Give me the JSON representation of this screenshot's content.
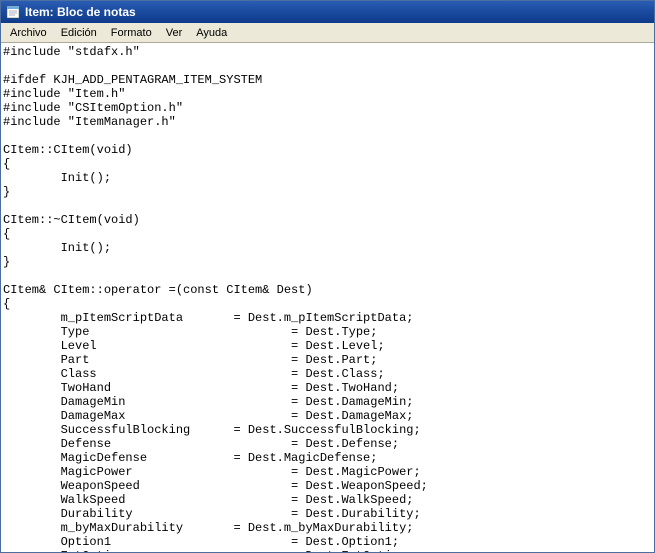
{
  "titlebar": {
    "title": "Item: Bloc de notas"
  },
  "menubar": {
    "items": [
      "Archivo",
      "Edición",
      "Formato",
      "Ver",
      "Ayuda"
    ]
  },
  "content": {
    "text": "#include \"stdafx.h\"\n\n#ifdef KJH_ADD_PENTAGRAM_ITEM_SYSTEM\n#include \"Item.h\"\n#include \"CSItemOption.h\"\n#include \"ItemManager.h\"\n\nCItem::CItem(void)\n{\n        Init();\n}\n\nCItem::~CItem(void)\n{\n        Init();\n}\n\nCItem& CItem::operator =(const CItem& Dest)\n{\n        m_pItemScriptData       = Dest.m_pItemScriptData;\n        Type                            = Dest.Type;\n        Level                           = Dest.Level;\n        Part                            = Dest.Part;\n        Class                           = Dest.Class;\n        TwoHand                         = Dest.TwoHand;\n        DamageMin                       = Dest.DamageMin;\n        DamageMax                       = Dest.DamageMax;\n        SuccessfulBlocking      = Dest.SuccessfulBlocking;\n        Defense                         = Dest.Defense;\n        MagicDefense            = Dest.MagicDefense;\n        MagicPower                      = Dest.MagicPower;\n        WeaponSpeed                     = Dest.WeaponSpeed;\n        WalkSpeed                       = Dest.WalkSpeed;\n        Durability                      = Dest.Durability;\n        m_byMaxDurability       = Dest.m_byMaxDurability;\n        Option1                         = Dest.Option1;\n        ExtOption                       = Dest.ExtOption;\n        RequireStrength         = Dest.RequireStrength;\n        RequireDexterity        = Dest.RequireDexterity;"
  }
}
